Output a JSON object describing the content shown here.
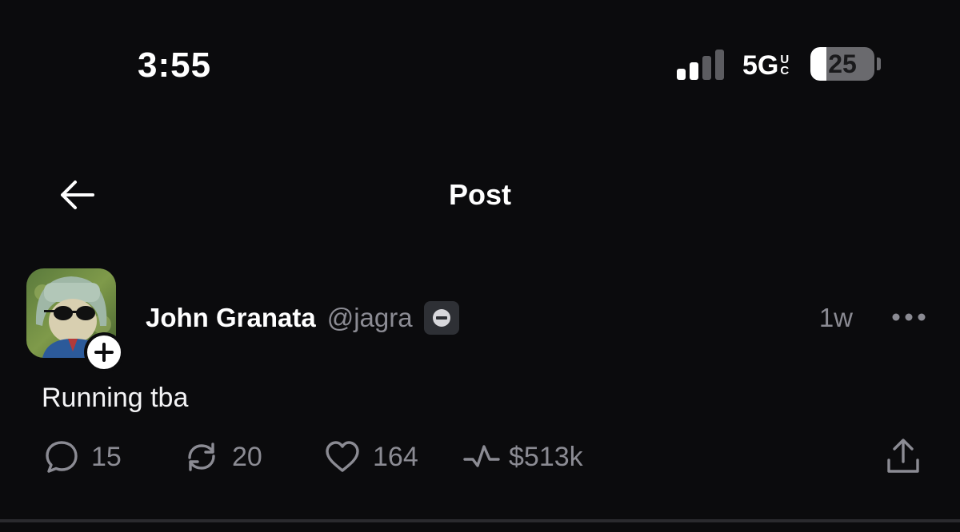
{
  "status_bar": {
    "time": "3:55",
    "network": "5G",
    "network_suffix_top": "U",
    "network_suffix_bottom": "C",
    "battery_level": "25",
    "battery_fraction": 0.25,
    "signal_bars_active": 2,
    "signal_bars_total": 4
  },
  "nav": {
    "back_icon": "arrow-left-icon",
    "title": "Post"
  },
  "post": {
    "author_name": "John Granata",
    "author_handle": "@jagra",
    "badge_icon": "minus-circle-icon",
    "timestamp": "1w",
    "text": "Running tba",
    "actions": {
      "replies": "15",
      "reposts": "20",
      "likes": "164",
      "volume": "$513k"
    }
  },
  "colors": {
    "background": "#0b0b0d",
    "text_primary": "#ffffff",
    "text_secondary": "#8b8b93",
    "badge_bg": "#2e3035"
  }
}
